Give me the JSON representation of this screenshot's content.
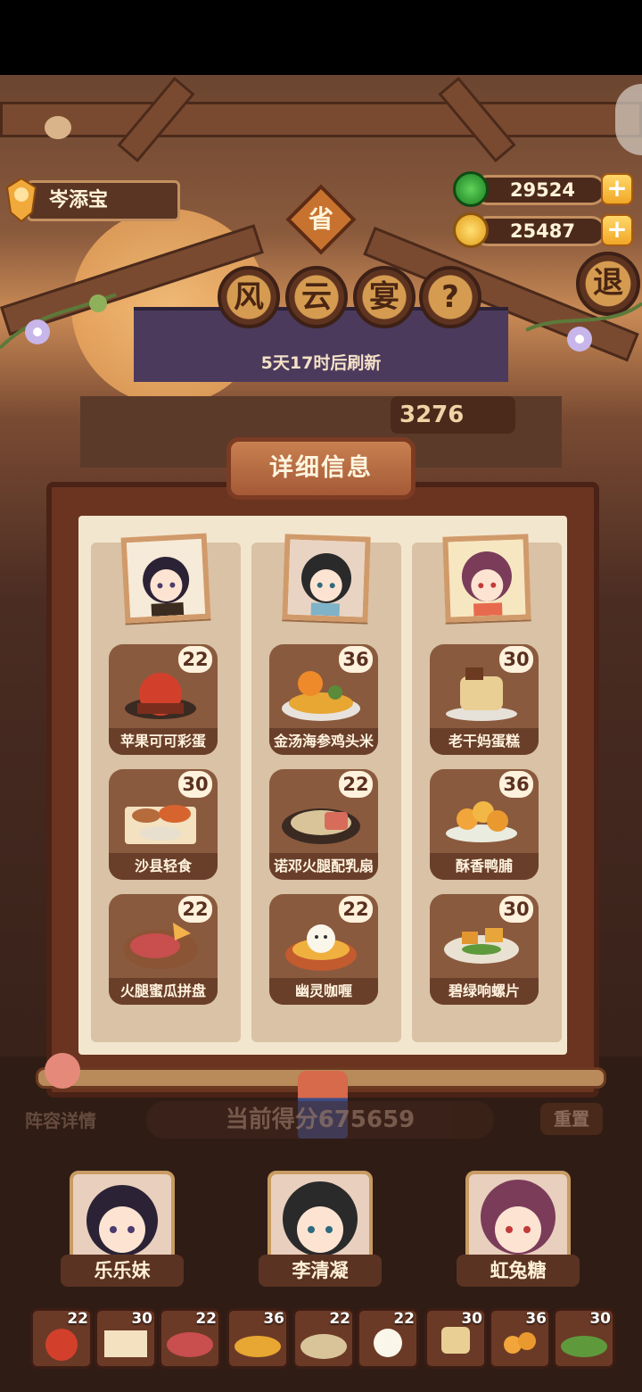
{
  "player": {
    "name": "岑添宝"
  },
  "currency": {
    "jade": "29524",
    "coin": "25487"
  },
  "badge": {
    "province": "省"
  },
  "title": {
    "chars": [
      "风",
      "云",
      "宴"
    ],
    "help": "?"
  },
  "exit_label": "退",
  "refresh_text": "5天17时后刷新",
  "score_tab": "3276",
  "panel": {
    "title": "详细信息",
    "columns": [
      {
        "dishes": [
          {
            "name": "苹果可可彩蛋",
            "score": "22"
          },
          {
            "name": "沙县轻食",
            "score": "30"
          },
          {
            "name": "火腿蜜瓜拼盘",
            "score": "22"
          }
        ]
      },
      {
        "dishes": [
          {
            "name": "金汤海参鸡头米",
            "score": "36"
          },
          {
            "name": "诺邓火腿配乳扇",
            "score": "22"
          },
          {
            "name": "幽灵咖喱",
            "score": "22"
          }
        ]
      },
      {
        "dishes": [
          {
            "name": "老干妈蛋糕",
            "score": "30"
          },
          {
            "name": "酥香鸭脯",
            "score": "36"
          },
          {
            "name": "碧绿响螺片",
            "score": "30"
          }
        ]
      }
    ]
  },
  "bottom": {
    "lineup_label": "阵容详情",
    "current_score": "当前得分675659",
    "reset_label": "重置",
    "team": [
      {
        "name": "乐乐妹"
      },
      {
        "name": "李清凝"
      },
      {
        "name": "虹兔糖"
      }
    ],
    "mini_scores": [
      "22",
      "30",
      "22",
      "36",
      "22",
      "22",
      "30",
      "36",
      "30"
    ]
  }
}
